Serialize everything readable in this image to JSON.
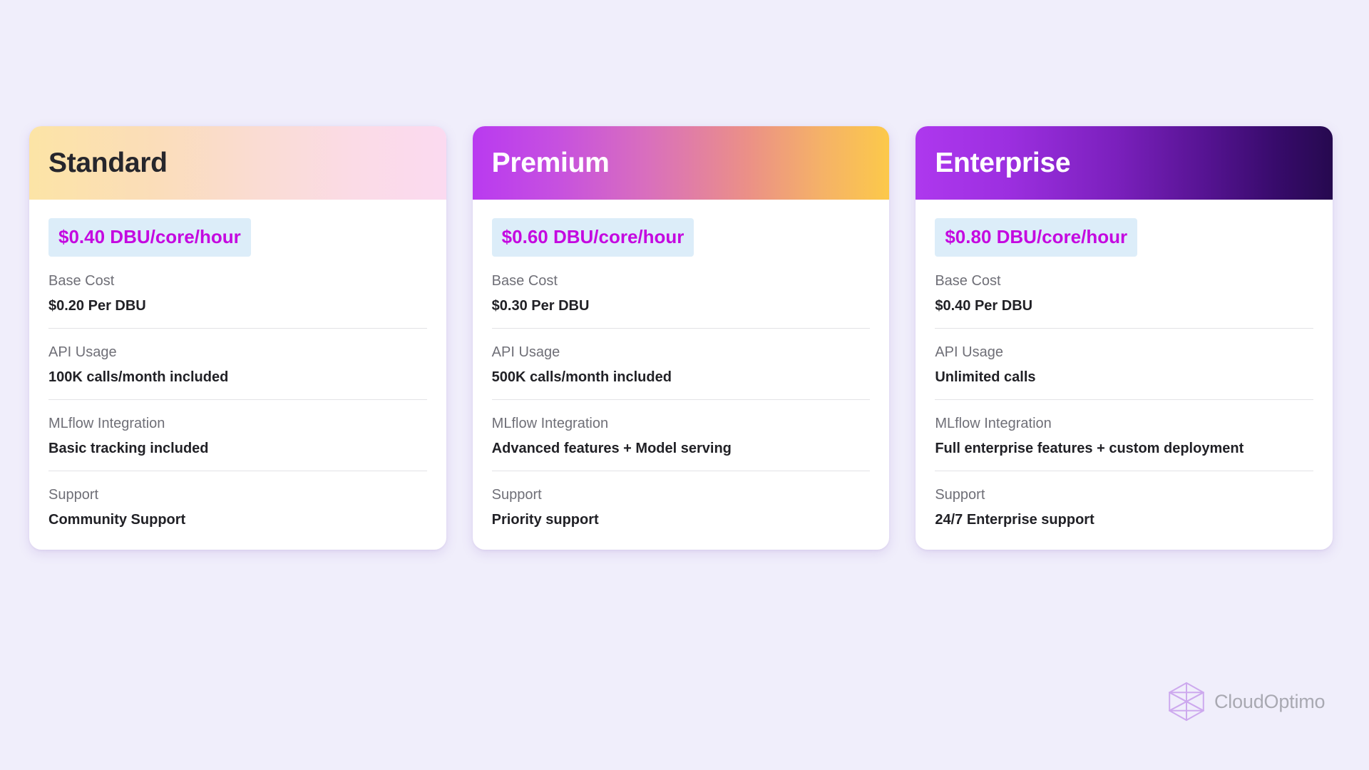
{
  "page": {
    "background_color": "#F0EEFB"
  },
  "cards": [
    {
      "id": "standard",
      "title": "Standard",
      "price": "$0.40 DBU/core/hour",
      "header_gradient_from": "#FCE4A6",
      "header_gradient_to": "#FBDAF0",
      "title_color": "#26262C",
      "features": [
        {
          "label": "Base Cost",
          "value": "$0.20 Per DBU"
        },
        {
          "label": "API Usage",
          "value": "100K calls/month included"
        },
        {
          "label": "MLflow Integration",
          "value": "Basic tracking included"
        },
        {
          "label": "Support",
          "value": "Community Support"
        }
      ]
    },
    {
      "id": "premium",
      "title": "Premium",
      "price": "$0.60 DBU/core/hour",
      "header_gradient_from": "#B93AF0",
      "header_gradient_to": "#FCC94A",
      "title_color": "#FFFFFF",
      "features": [
        {
          "label": "Base Cost",
          "value": "$0.30 Per DBU"
        },
        {
          "label": "API Usage",
          "value": "500K calls/month included"
        },
        {
          "label": "MLflow Integration",
          "value": "Advanced features + Model serving"
        },
        {
          "label": "Support",
          "value": "Priority support"
        }
      ]
    },
    {
      "id": "enterprise",
      "title": "Enterprise",
      "price": "$0.80 DBU/core/hour",
      "header_gradient_from": "#AE38EE",
      "header_gradient_to": "#26094F",
      "title_color": "#FFFFFF",
      "features": [
        {
          "label": "Base Cost",
          "value": "$0.40 Per DBU"
        },
        {
          "label": "API Usage",
          "value": "Unlimited calls"
        },
        {
          "label": "MLflow Integration",
          "value": "Full enterprise features + custom deployment"
        },
        {
          "label": "Support",
          "value": "24/7 Enterprise support"
        }
      ]
    }
  ],
  "badge_style": {
    "background_color": "#DCEDF9",
    "text_color": "#C409E0"
  },
  "logo": {
    "icon": "hexagon-wireframe-icon",
    "text": "CloudOptimo",
    "icon_color": "#CDA9EE",
    "text_color": "#A9A9B2"
  }
}
